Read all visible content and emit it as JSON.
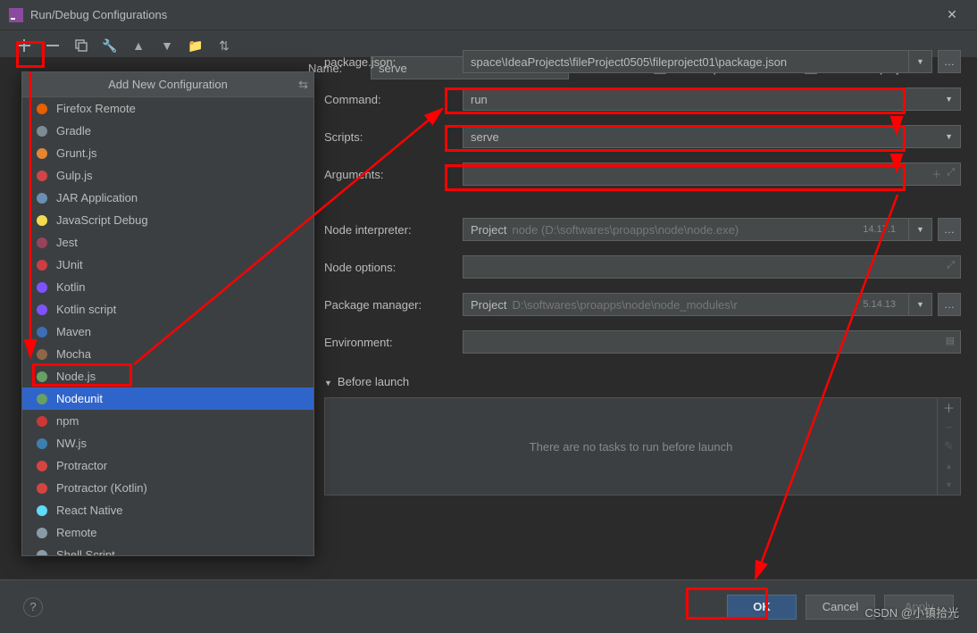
{
  "window": {
    "title": "Run/Debug Configurations"
  },
  "popup": {
    "title": "Add New Configuration",
    "items": [
      {
        "label": "Firefox Remote",
        "color": "#e66000"
      },
      {
        "label": "Gradle",
        "color": "#7d8b92"
      },
      {
        "label": "Grunt.js",
        "color": "#e48632"
      },
      {
        "label": "Gulp.js",
        "color": "#cf4647"
      },
      {
        "label": "JAR Application",
        "color": "#6a8fb5"
      },
      {
        "label": "JavaScript Debug",
        "color": "#f0db4f"
      },
      {
        "label": "Jest",
        "color": "#99425b"
      },
      {
        "label": "JUnit",
        "color": "#cc3e44"
      },
      {
        "label": "Kotlin",
        "color": "#7f52ff"
      },
      {
        "label": "Kotlin script",
        "color": "#7f52ff"
      },
      {
        "label": "Maven",
        "color": "#3b6fb6"
      },
      {
        "label": "Mocha",
        "color": "#8d6748"
      },
      {
        "label": "Node.js",
        "color": "#68a063"
      },
      {
        "label": "Nodeunit",
        "color": "#68a063",
        "selected": true
      },
      {
        "label": "npm",
        "color": "#cb3837"
      },
      {
        "label": "NW.js",
        "color": "#3e7fb1"
      },
      {
        "label": "Protractor",
        "color": "#d5453f"
      },
      {
        "label": "Protractor (Kotlin)",
        "color": "#d5453f"
      },
      {
        "label": "React Native",
        "color": "#61dafb"
      },
      {
        "label": "Remote",
        "color": "#8a9ba8"
      },
      {
        "label": "Shell Script",
        "color": "#8a9ba8"
      }
    ]
  },
  "form": {
    "name_label": "Name:",
    "name_value": "serve",
    "allow_parallel": "Allow parallel run",
    "store_project": "Store as project file",
    "package_json_label": "package.json:",
    "package_json_value": "space\\IdeaProjects\\fileProject0505\\fileproject01\\package.json",
    "command_label": "Command:",
    "command_value": "run",
    "scripts_label": "Scripts:",
    "scripts_value": "serve",
    "arguments_label": "Arguments:",
    "arguments_value": "",
    "node_interp_label": "Node interpreter:",
    "node_interp_prefix": "Project",
    "node_interp_value": "node (D:\\softwares\\proapps\\node\\node.exe)",
    "node_interp_version": "14.17.1",
    "node_opts_label": "Node options:",
    "node_opts_value": "",
    "pkg_mgr_label": "Package manager:",
    "pkg_mgr_prefix": "Project",
    "pkg_mgr_value": "D:\\softwares\\proapps\\node\\node_modules\\r",
    "pkg_mgr_version": "5.14.13",
    "env_label": "Environment:",
    "env_value": "",
    "before_launch": "Before launch",
    "no_tasks": "There are no tasks to run before launch"
  },
  "buttons": {
    "ok": "OK",
    "cancel": "Cancel",
    "apply": "Apply"
  },
  "watermark": "CSDN @小镇拾光"
}
